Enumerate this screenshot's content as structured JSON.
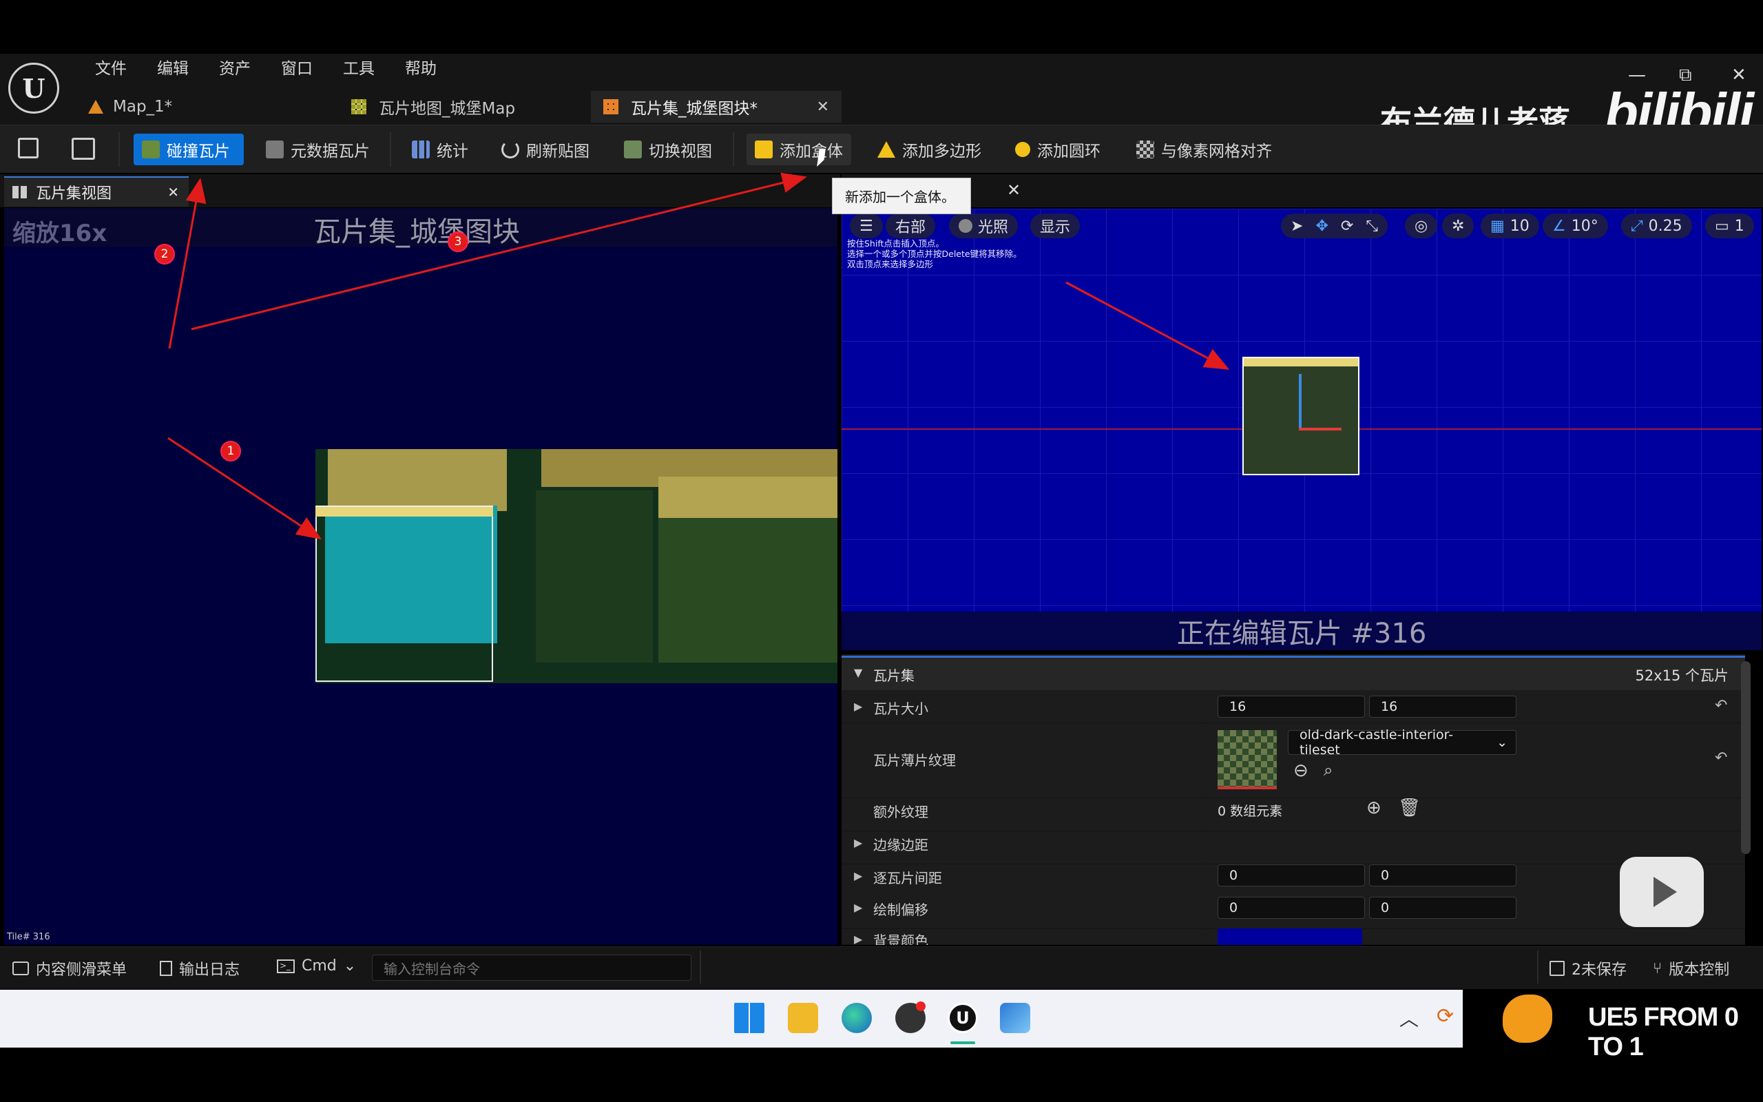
{
  "menu": [
    "文件",
    "编辑",
    "资产",
    "窗口",
    "工具",
    "帮助"
  ],
  "tabs": [
    {
      "label": "Map_1*",
      "icon": "level-icon"
    },
    {
      "label": "瓦片地图_城堡Map",
      "icon": "tilemap-icon"
    },
    {
      "label": "瓦片集_城堡图块*",
      "icon": "tileset-icon",
      "active": true
    }
  ],
  "window_controls": {
    "minimize": "—",
    "restore": "⧉",
    "close": "✕"
  },
  "toolbar": {
    "collision_tile": "碰撞瓦片",
    "metadata_tile": "元数据瓦片",
    "stats": "统计",
    "refresh_texture": "刷新贴图",
    "toggle_view": "切换视图",
    "add_box": "添加盒体",
    "add_polygon": "添加多边形",
    "add_circle": "添加圆环",
    "snap_pixel_grid": "与像素网格对齐"
  },
  "tooltip": "新添加一个盒体。",
  "left_panel": {
    "tab_label": "瓦片集视图",
    "zoom": "缩放16x",
    "title": "瓦片集_城堡图块",
    "tile_label": "Tile# 316"
  },
  "viewport": {
    "view_mode": "右部",
    "lighting": "光照",
    "show": "显示",
    "grid_value": "10",
    "angle_value": "10°",
    "scale_value": "0.25",
    "camera_speed": "1",
    "hint_lines": [
      "按住Shift点击插入顶点。",
      "选择一个或多个顶点并按Delete键将其移除。",
      "双击顶点来选择多边形"
    ],
    "editing_label": "正在编辑瓦片 #316"
  },
  "details": {
    "section": "瓦片集",
    "section_value": "52x15 个瓦片",
    "tile_size_label": "瓦片大小",
    "tile_size": [
      "16",
      "16"
    ],
    "tile_sheet_texture_label": "瓦片薄片纹理",
    "tile_sheet_texture": "old-dark-castle-interior-tileset",
    "extra_textures_label": "额外纹理",
    "extra_textures_value": "0 数组元素",
    "border_margin_label": "边缘边距",
    "per_tile_spacing_label": "逐瓦片间距",
    "per_tile_spacing": [
      "0",
      "0"
    ],
    "draw_offset_label": "绘制偏移",
    "draw_offset": [
      "0",
      "0"
    ],
    "background_color_label": "背景颜色",
    "background_color": "#00009e"
  },
  "statusbar": {
    "content_drawer": "内容侧滑菜单",
    "output_log": "输出日志",
    "cmd": "Cmd",
    "cmd_placeholder": "输入控制台命令",
    "unsaved": "2未保存",
    "source_control": "版本控制"
  },
  "watermark": {
    "author": "布兰德儿老蒋",
    "brand": "bilibili",
    "series": "UE5 FROM 0 TO 1"
  },
  "annotations": [
    "1",
    "2",
    "3"
  ],
  "colors": {
    "accent": "#0b70d6",
    "tile_view_bg": "#00003d",
    "viewport_bg": "#00009e",
    "annotation": "#e21b1b"
  }
}
